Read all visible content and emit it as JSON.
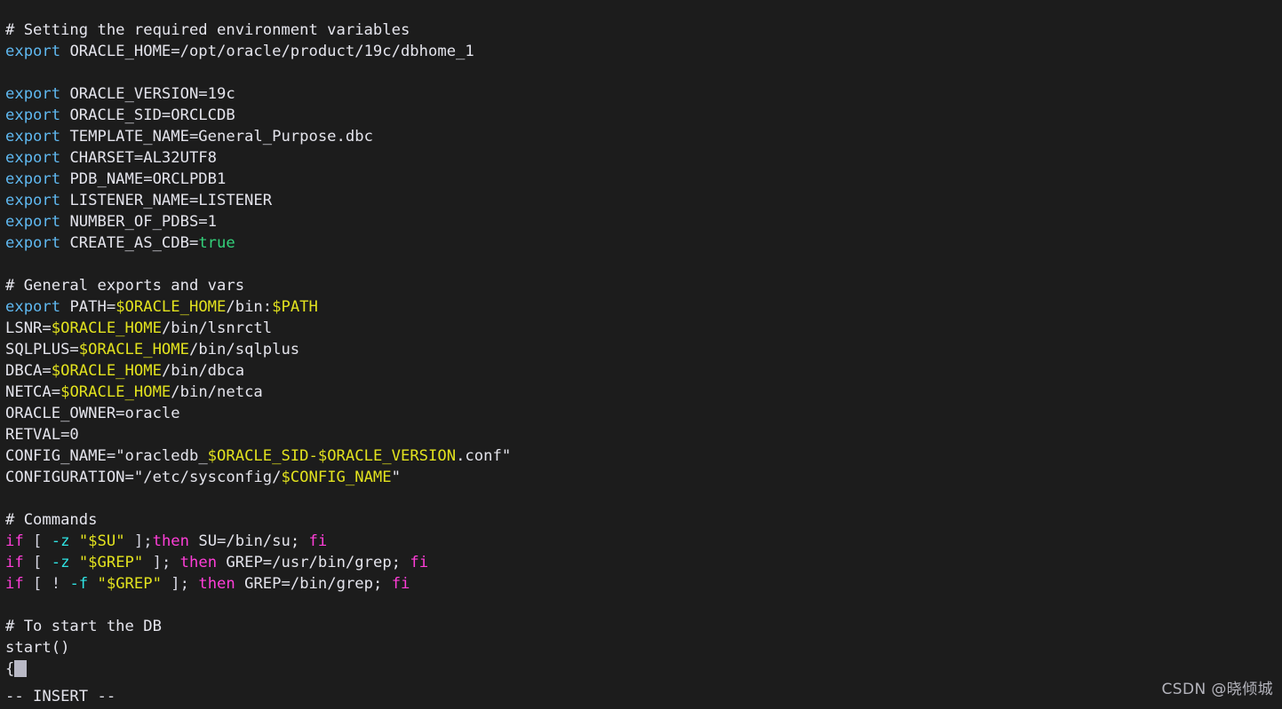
{
  "editor": {
    "app": "vim",
    "mode_status": "-- INSERT --",
    "background_color": "#1c1c1c",
    "cursor": {
      "shape": "block",
      "color": "#b9b9c6",
      "line": 31,
      "column": 2
    },
    "colors": {
      "comment": "#e6e6ee",
      "plain": "#e4e4ec",
      "keyword": "#5fb8f0",
      "variable": "#e2e21e",
      "boolean": "#33d17a",
      "conditional": "#ff3ed8",
      "flag": "#2fe3e3",
      "string": "#e2e21e"
    }
  },
  "watermark": {
    "text": "CSDN @晓倾城"
  },
  "lines": [
    {
      "n": 1,
      "tokens": [
        {
          "c": "t-comment",
          "t": "# Setting the required environment variables"
        }
      ]
    },
    {
      "n": 2,
      "tokens": [
        {
          "c": "t-keyword",
          "t": "export"
        },
        {
          "c": "t-plain",
          "t": " ORACLE_HOME=/opt/oracle/product/19c/dbhome_1"
        }
      ]
    },
    {
      "n": 3,
      "tokens": []
    },
    {
      "n": 4,
      "tokens": [
        {
          "c": "t-keyword",
          "t": "export"
        },
        {
          "c": "t-plain",
          "t": " ORACLE_VERSION=19c"
        }
      ]
    },
    {
      "n": 5,
      "tokens": [
        {
          "c": "t-keyword",
          "t": "export"
        },
        {
          "c": "t-plain",
          "t": " ORACLE_SID=ORCLCDB"
        }
      ]
    },
    {
      "n": 6,
      "tokens": [
        {
          "c": "t-keyword",
          "t": "export"
        },
        {
          "c": "t-plain",
          "t": " TEMPLATE_NAME=General_Purpose.dbc"
        }
      ]
    },
    {
      "n": 7,
      "tokens": [
        {
          "c": "t-keyword",
          "t": "export"
        },
        {
          "c": "t-plain",
          "t": " CHARSET=AL32UTF8"
        }
      ]
    },
    {
      "n": 8,
      "tokens": [
        {
          "c": "t-keyword",
          "t": "export"
        },
        {
          "c": "t-plain",
          "t": " PDB_NAME=ORCLPDB1"
        }
      ]
    },
    {
      "n": 9,
      "tokens": [
        {
          "c": "t-keyword",
          "t": "export"
        },
        {
          "c": "t-plain",
          "t": " LISTENER_NAME=LISTENER"
        }
      ]
    },
    {
      "n": 10,
      "tokens": [
        {
          "c": "t-keyword",
          "t": "export"
        },
        {
          "c": "t-plain",
          "t": " NUMBER_OF_PDBS=1"
        }
      ]
    },
    {
      "n": 11,
      "tokens": [
        {
          "c": "t-keyword",
          "t": "export"
        },
        {
          "c": "t-plain",
          "t": " CREATE_AS_CDB="
        },
        {
          "c": "t-bool",
          "t": "true"
        }
      ]
    },
    {
      "n": 12,
      "tokens": []
    },
    {
      "n": 13,
      "tokens": [
        {
          "c": "t-comment",
          "t": "# General exports and vars"
        }
      ]
    },
    {
      "n": 14,
      "tokens": [
        {
          "c": "t-keyword",
          "t": "export"
        },
        {
          "c": "t-plain",
          "t": " PATH="
        },
        {
          "c": "t-var",
          "t": "$ORACLE_HOME"
        },
        {
          "c": "t-plain",
          "t": "/bin:"
        },
        {
          "c": "t-var",
          "t": "$PATH"
        }
      ]
    },
    {
      "n": 15,
      "tokens": [
        {
          "c": "t-plain",
          "t": "LSNR="
        },
        {
          "c": "t-var",
          "t": "$ORACLE_HOME"
        },
        {
          "c": "t-plain",
          "t": "/bin/lsnrctl"
        }
      ]
    },
    {
      "n": 16,
      "tokens": [
        {
          "c": "t-plain",
          "t": "SQLPLUS="
        },
        {
          "c": "t-var",
          "t": "$ORACLE_HOME"
        },
        {
          "c": "t-plain",
          "t": "/bin/sqlplus"
        }
      ]
    },
    {
      "n": 17,
      "tokens": [
        {
          "c": "t-plain",
          "t": "DBCA="
        },
        {
          "c": "t-var",
          "t": "$ORACLE_HOME"
        },
        {
          "c": "t-plain",
          "t": "/bin/dbca"
        }
      ]
    },
    {
      "n": 18,
      "tokens": [
        {
          "c": "t-plain",
          "t": "NETCA="
        },
        {
          "c": "t-var",
          "t": "$ORACLE_HOME"
        },
        {
          "c": "t-plain",
          "t": "/bin/netca"
        }
      ]
    },
    {
      "n": 19,
      "tokens": [
        {
          "c": "t-plain",
          "t": "ORACLE_OWNER=oracle"
        }
      ]
    },
    {
      "n": 20,
      "tokens": [
        {
          "c": "t-plain",
          "t": "RETVAL=0"
        }
      ]
    },
    {
      "n": 21,
      "tokens": [
        {
          "c": "t-plain",
          "t": "CONFIG_NAME="
        },
        {
          "c": "t-plain",
          "t": "\"oracledb_"
        },
        {
          "c": "t-var",
          "t": "$ORACLE_SID"
        },
        {
          "c": "t-var",
          "t": "-"
        },
        {
          "c": "t-var",
          "t": "$ORACLE_VERSION"
        },
        {
          "c": "t-plain",
          "t": ".conf\""
        }
      ]
    },
    {
      "n": 22,
      "tokens": [
        {
          "c": "t-plain",
          "t": "CONFIGURATION="
        },
        {
          "c": "t-plain",
          "t": "\"/etc/sysconfig/"
        },
        {
          "c": "t-var",
          "t": "$CONFIG_NAME"
        },
        {
          "c": "t-plain",
          "t": "\""
        }
      ]
    },
    {
      "n": 23,
      "tokens": []
    },
    {
      "n": 24,
      "tokens": [
        {
          "c": "t-comment",
          "t": "# Commands"
        }
      ]
    },
    {
      "n": 25,
      "tokens": [
        {
          "c": "t-cond",
          "t": "if"
        },
        {
          "c": "t-punct",
          "t": " [ "
        },
        {
          "c": "t-flag",
          "t": "-z"
        },
        {
          "c": "t-punct",
          "t": " "
        },
        {
          "c": "t-var",
          "t": "\"$SU\""
        },
        {
          "c": "t-punct",
          "t": " ];"
        },
        {
          "c": "t-cond",
          "t": "then"
        },
        {
          "c": "t-plain",
          "t": " SU=/bin/su; "
        },
        {
          "c": "t-cond",
          "t": "fi"
        }
      ]
    },
    {
      "n": 26,
      "tokens": [
        {
          "c": "t-cond",
          "t": "if"
        },
        {
          "c": "t-punct",
          "t": " [ "
        },
        {
          "c": "t-flag",
          "t": "-z"
        },
        {
          "c": "t-punct",
          "t": " "
        },
        {
          "c": "t-var",
          "t": "\"$GREP\""
        },
        {
          "c": "t-punct",
          "t": " ]; "
        },
        {
          "c": "t-cond",
          "t": "then"
        },
        {
          "c": "t-plain",
          "t": " GREP=/usr/bin/grep; "
        },
        {
          "c": "t-cond",
          "t": "fi"
        }
      ]
    },
    {
      "n": 27,
      "tokens": [
        {
          "c": "t-cond",
          "t": "if"
        },
        {
          "c": "t-punct",
          "t": " [ ! "
        },
        {
          "c": "t-flag",
          "t": "-f"
        },
        {
          "c": "t-punct",
          "t": " "
        },
        {
          "c": "t-var",
          "t": "\"$GREP\""
        },
        {
          "c": "t-punct",
          "t": " ]; "
        },
        {
          "c": "t-cond",
          "t": "then"
        },
        {
          "c": "t-plain",
          "t": " GREP=/bin/grep; "
        },
        {
          "c": "t-cond",
          "t": "fi"
        }
      ]
    },
    {
      "n": 28,
      "tokens": []
    },
    {
      "n": 29,
      "tokens": [
        {
          "c": "t-comment",
          "t": "# To start the DB"
        }
      ]
    },
    {
      "n": 30,
      "tokens": [
        {
          "c": "t-plain",
          "t": "start()"
        }
      ]
    },
    {
      "n": 31,
      "tokens": [
        {
          "c": "t-plain",
          "t": "{"
        }
      ],
      "cursor_after": true
    }
  ]
}
